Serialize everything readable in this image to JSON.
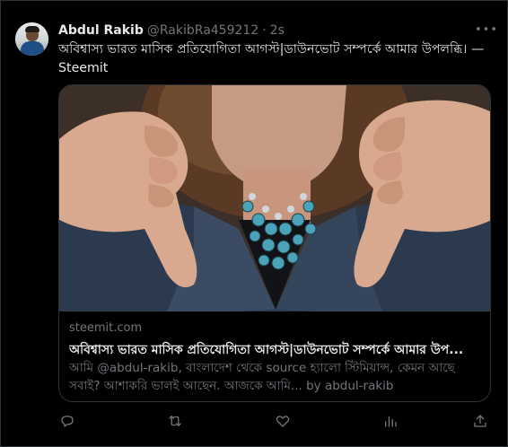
{
  "tweet": {
    "author_name": "Abdul Rakib",
    "author_handle": "@RakibRa459212",
    "separator": "·",
    "time": "2s",
    "more_label": "•••",
    "text": "অবিশ্বাস্য ভারত মাসিক প্রতিযোগিতা আগস্ট|ডাউনভোট সম্পর্কে আমার উপলব্ধি। — Steemit"
  },
  "card": {
    "domain": "steemit.com",
    "title": "অবিশ্বাস্য ভারত মাসিক প্রতিযোগিতা আগস্ট|ডাউনভোট সম্পর্কে আমার উপ...",
    "description": "আমি @abdul-rakib, বাংলাদেশ থেকে source হ্যালো স্টিমিয়ান্স, কেমন আছে সবাই? আশাকরি ভালই আছেন. আজকে আমি... by abdul-rakib"
  },
  "actions": [
    {
      "name": "reply-icon"
    },
    {
      "name": "retweet-icon"
    },
    {
      "name": "like-icon"
    },
    {
      "name": "views-icon"
    },
    {
      "name": "share-icon"
    }
  ],
  "colors": {
    "background": "#000000",
    "primary_text": "#e7e9ea",
    "secondary_text": "#71767b",
    "border": "#2f3336"
  }
}
